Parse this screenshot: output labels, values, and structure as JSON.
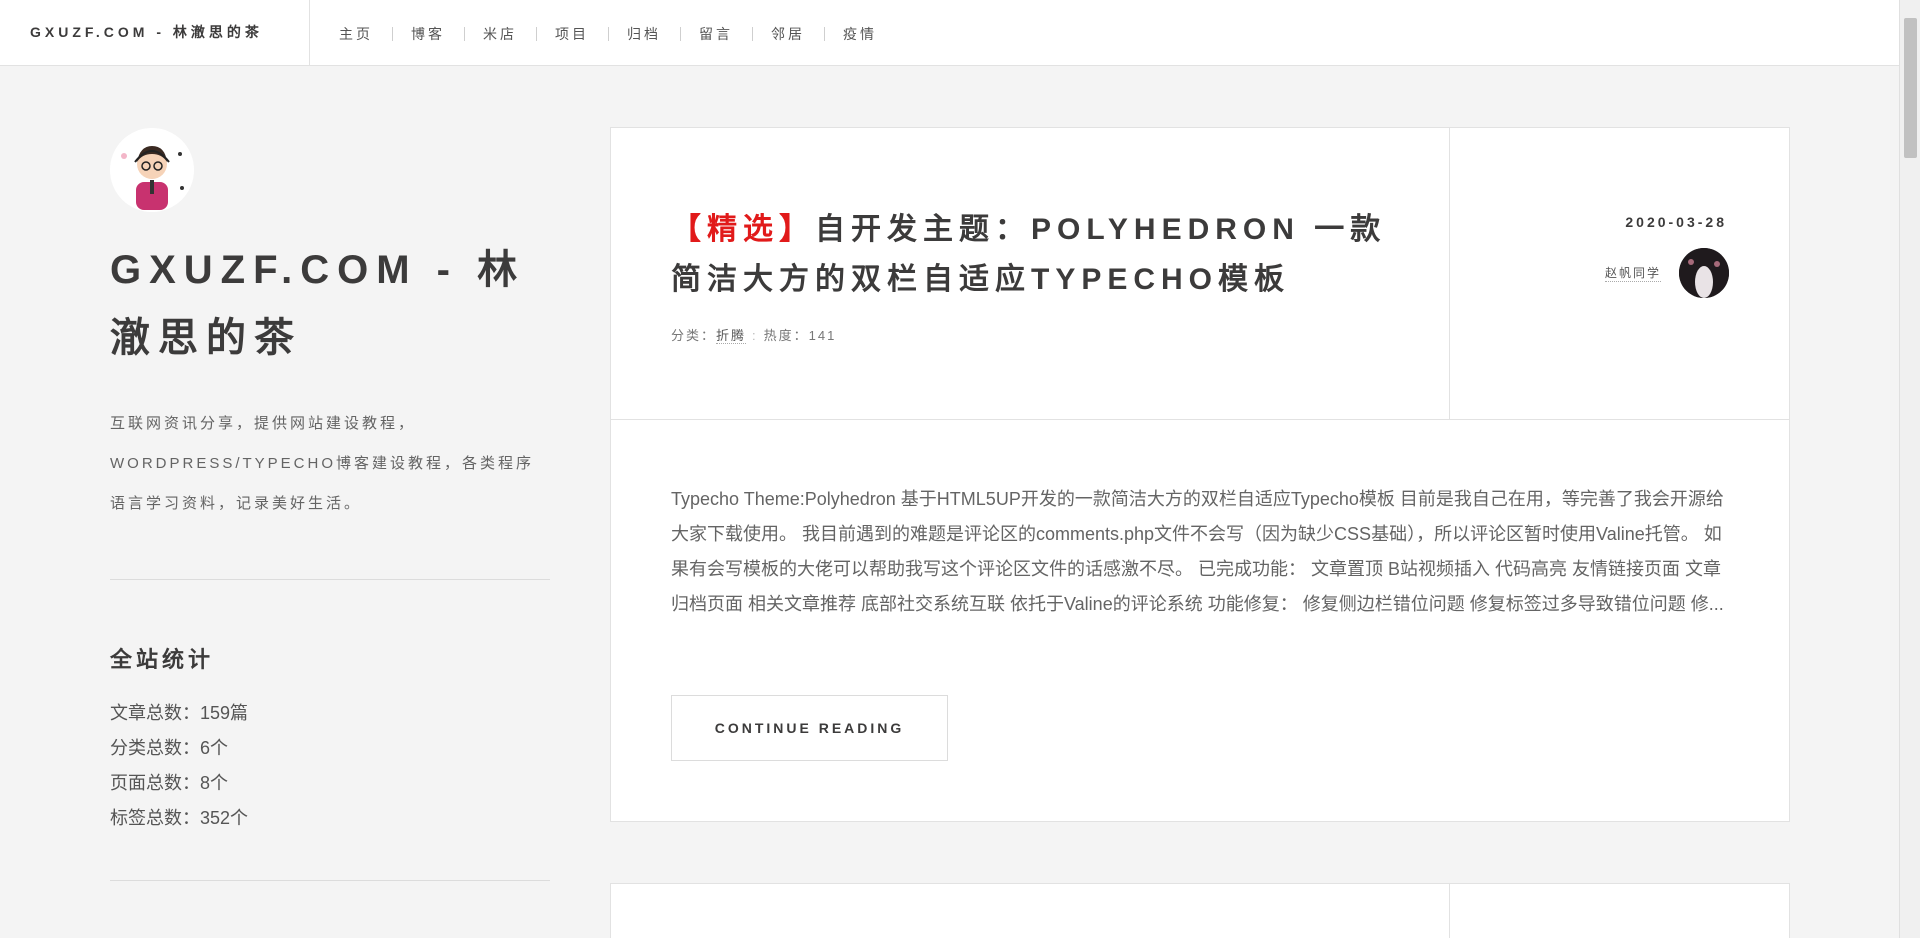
{
  "header": {
    "site_title": "GXUZF.COM - 林澈思的茶",
    "nav": [
      "主页",
      "博客",
      "米店",
      "项目",
      "归档",
      "留言",
      "邻居",
      "疫情"
    ]
  },
  "sidebar": {
    "title": "GXUZF.COM - 林澈思的茶",
    "description": "互联网资讯分享，提供网站建设教程，WORDPRESS/TYPECHO博客建设教程，各类程序语言学习资料，记录美好生活。",
    "stats_title": "全站统计",
    "stats": [
      "文章总数：159篇",
      "分类总数：6个",
      "页面总数：8个",
      "标签总数：352个"
    ]
  },
  "post": {
    "featured_tag": "【精选】",
    "title": "自开发主题：POLYHEDRON 一款简洁大方的双栏自适应TYPECHO模板",
    "meta": {
      "category_label": "分类：",
      "category": "折腾",
      "separator": ":",
      "views_label": "热度：",
      "views": "141"
    },
    "date": "2020-03-28",
    "author": "赵帆同学",
    "excerpt": "Typecho Theme:Polyhedron 基于HTML5UP开发的一款简洁大方的双栏自适应Typecho模板 目前是我自己在用，等完善了我会开源给大家下载使用。 我目前遇到的难题是评论区的comments.php文件不会写（因为缺少CSS基础），所以评论区暂时使用Valine托管。 如果有会写模板的大佬可以帮助我写这个评论区文件的话感激不尽。 已完成功能： 文章置顶 B站视频插入 代码高亮 友情链接页面 文章归档页面 相关文章推荐 底部社交系统互联 依托于Valine的评论系统 功能修复： 修复侧边栏错位问题 修复标签过多导致错位问题 修...",
    "continue_label": "CONTINUE READING"
  }
}
